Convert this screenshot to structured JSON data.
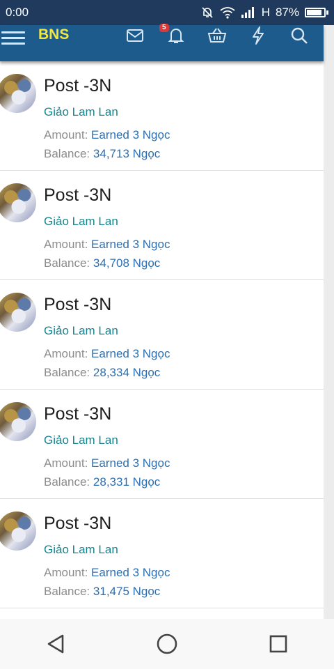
{
  "status": {
    "time": "0:00",
    "battery": "87%",
    "battery_level": 0.87,
    "network": "H"
  },
  "appbar": {
    "brand": "BNS",
    "notification_count": "5",
    "brand_color": "#f3e839",
    "bar_color": "#1c5b8c"
  },
  "labels": {
    "amount": "Amount:",
    "balance": "Balance:"
  },
  "entries": [
    {
      "title": "Post -3N",
      "author": "Giảo Lam Lan",
      "amount": "Earned 3 Ngọc",
      "balance": "34,713 Ngọc"
    },
    {
      "title": "Post -3N",
      "author": "Giảo Lam Lan",
      "amount": "Earned 3 Ngọc",
      "balance": "34,708 Ngọc"
    },
    {
      "title": "Post -3N",
      "author": "Giảo Lam Lan",
      "amount": "Earned 3 Ngọc",
      "balance": "28,334 Ngọc"
    },
    {
      "title": "Post -3N",
      "author": "Giảo Lam Lan",
      "amount": "Earned 3 Ngọc",
      "balance": "28,331 Ngọc"
    },
    {
      "title": "Post -3N",
      "author": "Giảo Lam Lan",
      "amount": "Earned 3 Ngọc",
      "balance": "31,475 Ngọc"
    }
  ],
  "icons": {
    "menu": "hamburger-menu-icon",
    "mail": "mail-icon",
    "bell": "bell-icon",
    "basket": "basket-icon",
    "bolt": "lightning-icon",
    "search": "search-icon",
    "back": "back-triangle-icon",
    "home": "home-circle-icon",
    "recents": "recents-square-icon"
  }
}
